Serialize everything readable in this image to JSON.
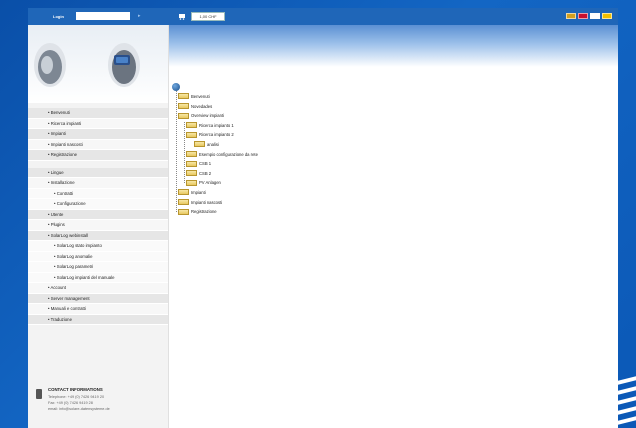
{
  "topbar": {
    "login_label": "Login",
    "login_value": "",
    "cart_label": "1,00 CHF",
    "flags": [
      {
        "name": "flag-de",
        "color": "#d4a020"
      },
      {
        "name": "flag-gb",
        "color": "#c8102e"
      },
      {
        "name": "flag-fr",
        "color": "#ffffff"
      },
      {
        "name": "flag-es",
        "color": "#f1bf00"
      }
    ]
  },
  "sidebar": {
    "menu_group1": [
      "Benvenuti",
      "Ricerca impianti",
      "Impianti",
      "Impianti nascosti",
      "Registrazione"
    ],
    "menu_group2": [
      {
        "label": "Lingue",
        "level": 0
      },
      {
        "label": "Installazione",
        "level": 0
      },
      {
        "label": "Contratti",
        "level": 1
      },
      {
        "label": "Configurazione",
        "level": 1
      },
      {
        "label": "Utente",
        "level": 0
      },
      {
        "label": "Plugins",
        "level": 0
      },
      {
        "label": "SolarLog webinstall",
        "level": 0
      },
      {
        "label": "SolarLog stato impianto",
        "level": 1
      },
      {
        "label": "SolarLog anomalie",
        "level": 1
      },
      {
        "label": "SolarLog parametri",
        "level": 1
      },
      {
        "label": "SolarLog impianti del manuale",
        "level": 1
      },
      {
        "label": "Account",
        "level": 0
      },
      {
        "label": "Server management",
        "level": 0
      },
      {
        "label": "Manuali e contratti",
        "level": 0
      },
      {
        "label": "Traduzione",
        "level": 0
      }
    ],
    "contact": {
      "title": "CONTACT INFORMATIONS",
      "phone": "Telephone: +49 (0) 7426 9419 20",
      "fax": "Fax: +49 (0) 7426 9419 28",
      "email": "email: info@solare-datensysteme.de"
    }
  },
  "tree": {
    "nodes": [
      {
        "label": "Benvenuti",
        "depth": 0
      },
      {
        "label": "Novedades",
        "depth": 0
      },
      {
        "label": "Overview impianti",
        "depth": 0
      },
      {
        "label": "Ricerca impianto 1",
        "depth": 1
      },
      {
        "label": "Ricerca impianto 2",
        "depth": 1
      },
      {
        "label": "analisi",
        "depth": 2
      },
      {
        "label": "Esempio configurazione da rete",
        "depth": 1
      },
      {
        "label": "CSB 1",
        "depth": 1
      },
      {
        "label": "CSB 2",
        "depth": 1
      },
      {
        "label": "PV Anlagen",
        "depth": 1
      },
      {
        "label": "Impianti",
        "depth": 0
      },
      {
        "label": "Impianti nascosti",
        "depth": 0
      },
      {
        "label": "Registrazione",
        "depth": 0
      }
    ]
  }
}
